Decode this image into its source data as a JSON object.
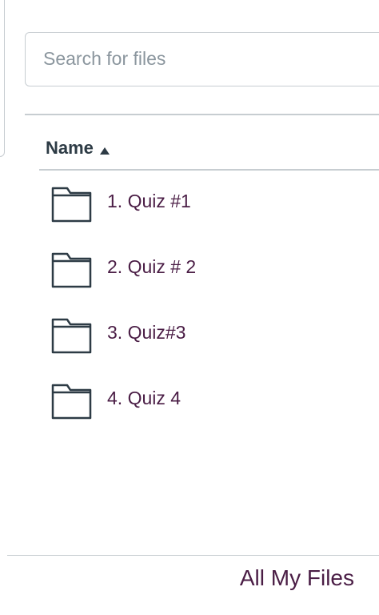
{
  "search": {
    "placeholder": "Search for files",
    "value": ""
  },
  "table": {
    "header": {
      "name_label": "Name",
      "sort_direction": "ascending",
      "sort_icon": "triangle-up-icon"
    },
    "rows": [
      {
        "name": "1. Quiz #1",
        "icon": "folder-icon"
      },
      {
        "name": "2. Quiz # 2",
        "icon": "folder-icon"
      },
      {
        "name": "3. Quiz#3",
        "icon": "folder-icon"
      },
      {
        "name": "4. Quiz 4",
        "icon": "folder-icon"
      }
    ]
  },
  "footer": {
    "link_label": "All My Files"
  },
  "colors": {
    "link": "#4a1d45",
    "text": "#2d3b45",
    "border": "#c7cdd1",
    "placeholder": "#8b969e"
  }
}
